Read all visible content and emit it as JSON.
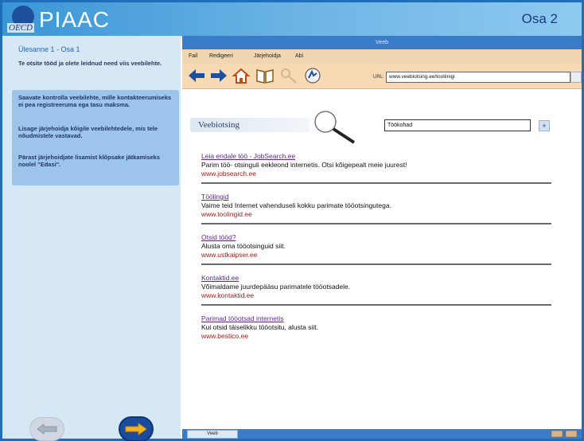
{
  "header": {
    "logo_sub": "OECD",
    "brand": "PIAAC",
    "section": "Osa 2"
  },
  "left": {
    "task_title": "Ülesanne 1 - Osa 1",
    "instruction": "Te otsite tööd ja olete leidnud need viis veebilehte.",
    "highlight": [
      "Saavate kontrolla veebilehte, mille kontakteerumiseks ei pea registreeruma ega tasu maksma.",
      "Lisage järjehoidja kõigile veebilehtedele, mis tele nõudmistele vastavad.",
      "Pärast järjehoidjate lisamist klõpsake jätkamiseks noolel \"Edasi\"."
    ],
    "back_icon": "arrow-left-icon",
    "next_icon": "arrow-right-icon"
  },
  "browser": {
    "title": "Veeb",
    "menu": [
      "Fail",
      "Redigeeri",
      "Järjehoidja",
      "Abi"
    ],
    "toolbar_icons": [
      "back-arrow-icon",
      "forward-arrow-icon",
      "home-icon",
      "bookmarks-book-icon",
      "search-key-icon",
      "add-bookmark-icon"
    ],
    "url_label": "URL:",
    "url_value": "www.veebiotsing.ee/tooliinigi",
    "site_name": "Veebiotsing",
    "search_value": "Töökohad",
    "search_button": "+",
    "results": [
      {
        "title": "Leia endale töö - JobSearch.ee",
        "desc": "Parim töö- otsinguli eekleond internetis. Otsi kõigepealt meie juurest!",
        "url": "www.jobsearch.ee"
      },
      {
        "title": "Töölingid",
        "desc": "Vaime teid Internet vahenduseli kokku parimate tööotsingutega.",
        "url": "www.toolingid.ee"
      },
      {
        "title": "Otsid tööd?",
        "desc": "Alusta oma tööotsinguid siit.",
        "url": "www.ustkaipser.ee"
      },
      {
        "title": "Kontaktid.ee",
        "desc": "Võimaldame juurdepääsu parimatele tööotsadele.",
        "url": "www.kontaktid.ee"
      },
      {
        "title": "Parimad tööotsad internetis",
        "desc": "Kui otsid täiselikku tööotsitu, alusta siit.",
        "url": "www.bestico.ee"
      }
    ],
    "status_tab": "Veeb"
  },
  "colors": {
    "header_blue": "#3a95d6",
    "panel_blue": "#d6e7f6",
    "highlight_blue": "#9dc4ea",
    "toolbar_tan": "#f7d9b4",
    "link_purple": "#5b2a8c",
    "url_red": "#9c1b1b"
  }
}
